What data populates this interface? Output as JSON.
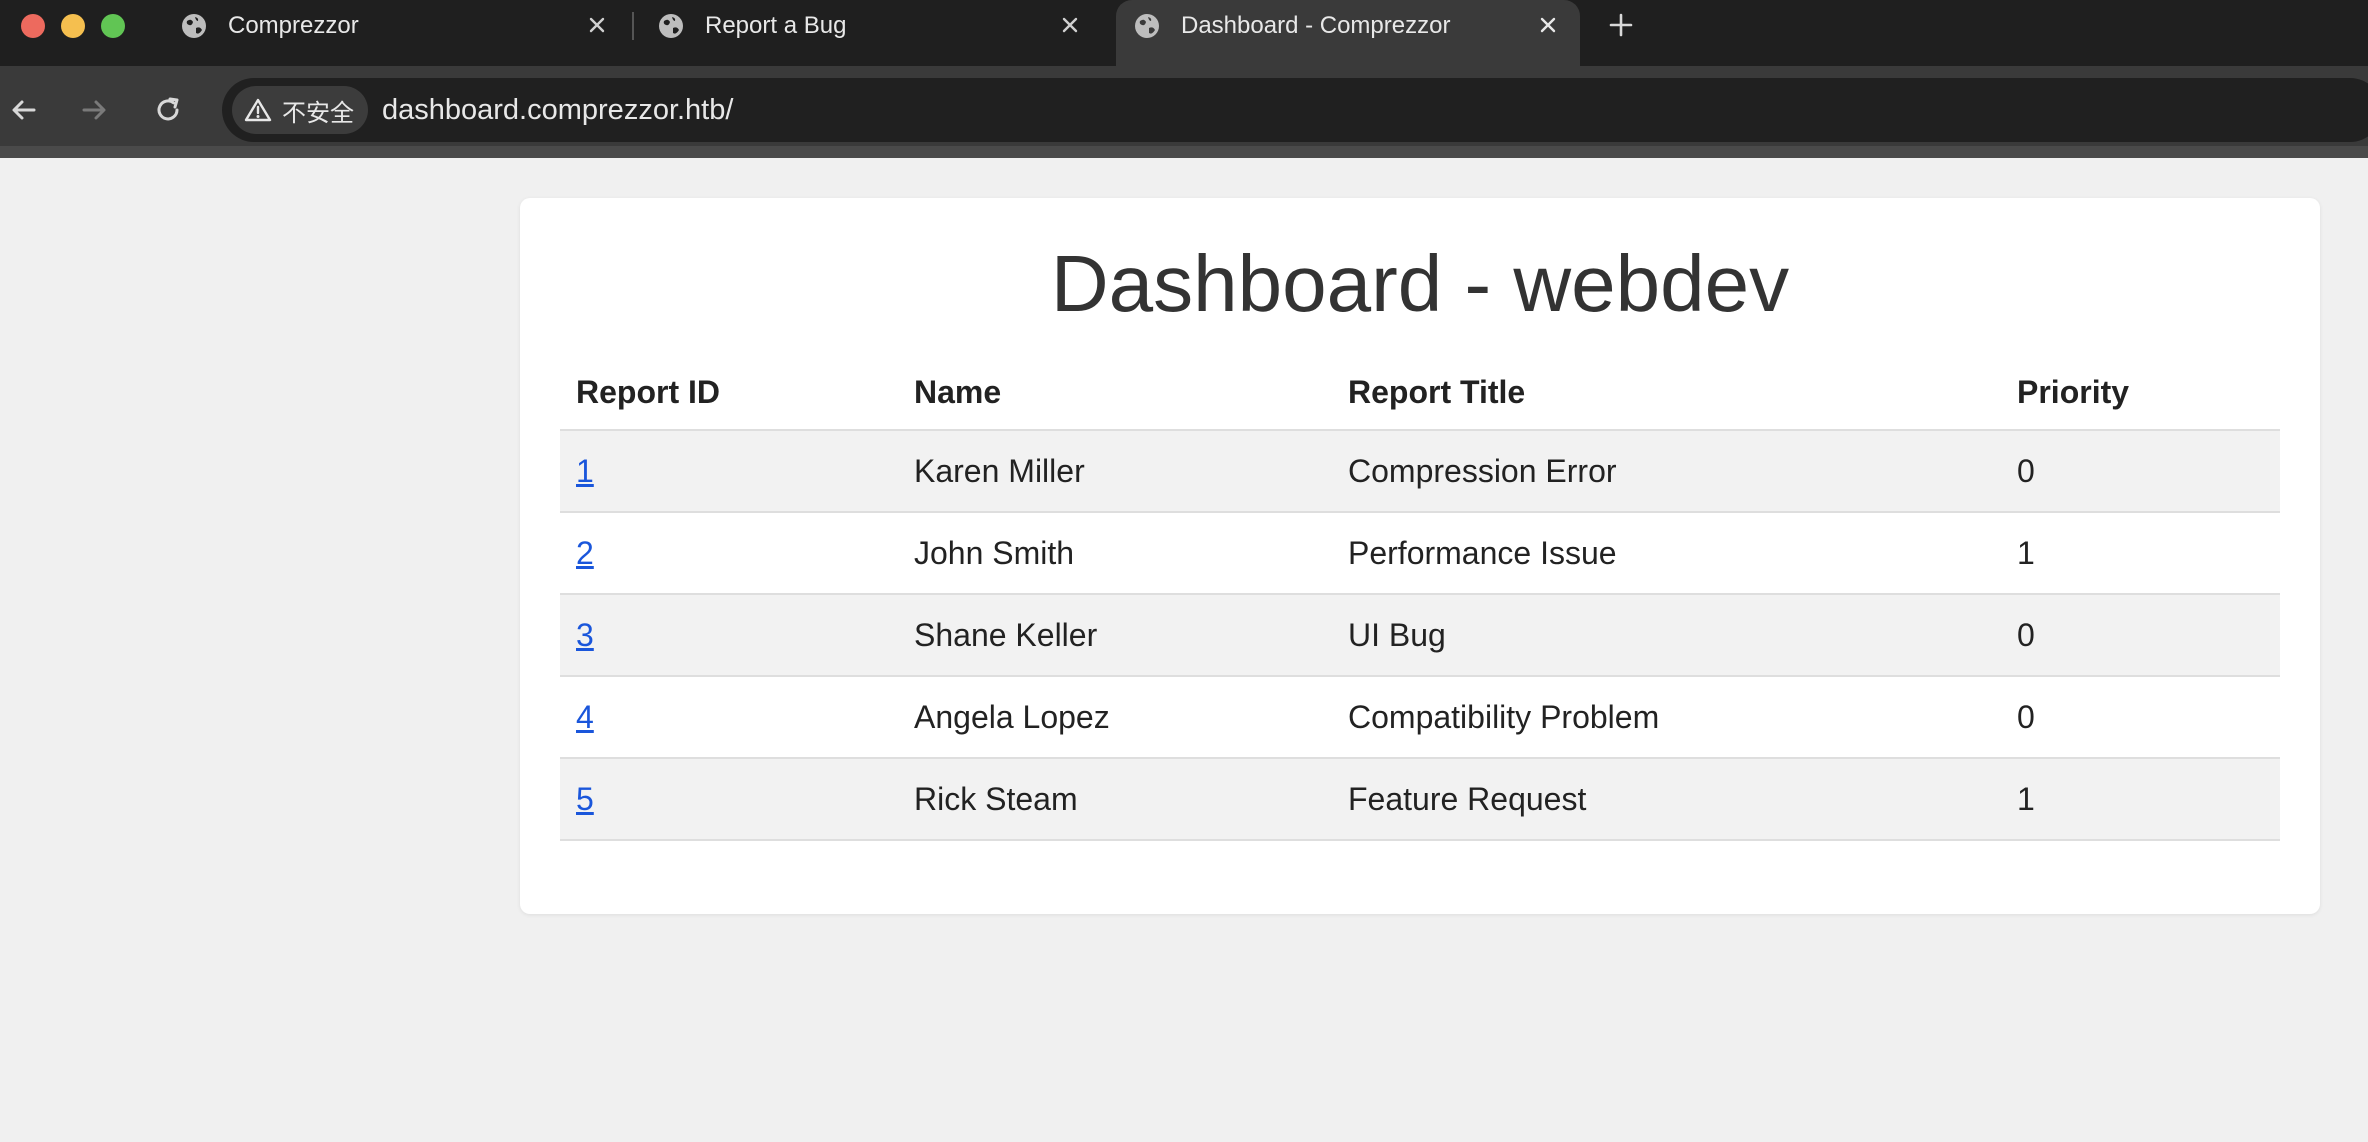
{
  "browser": {
    "tabs": [
      {
        "title": "Comprezzor",
        "active": false
      },
      {
        "title": "Report a Bug",
        "active": false
      },
      {
        "title": "Dashboard - Comprezzor",
        "active": true
      }
    ],
    "security_label": "不安全",
    "url": "dashboard.comprezzor.htb/"
  },
  "page": {
    "title": "Dashboard - webdev",
    "table": {
      "headers": [
        "Report ID",
        "Name",
        "Report Title",
        "Priority"
      ],
      "rows": [
        {
          "id": "1",
          "name": "Karen Miller",
          "title": "Compression Error",
          "priority": "0"
        },
        {
          "id": "2",
          "name": "John Smith",
          "title": "Performance Issue",
          "priority": "1"
        },
        {
          "id": "3",
          "name": "Shane Keller",
          "title": "UI Bug",
          "priority": "0"
        },
        {
          "id": "4",
          "name": "Angela Lopez",
          "title": "Compatibility Problem",
          "priority": "0"
        },
        {
          "id": "5",
          "name": "Rick Steam",
          "title": "Feature Request",
          "priority": "1"
        }
      ]
    }
  },
  "colors": {
    "link": "#1a56db",
    "row_alt": "#f2f2f2",
    "page_bg": "#f0f0f0"
  }
}
